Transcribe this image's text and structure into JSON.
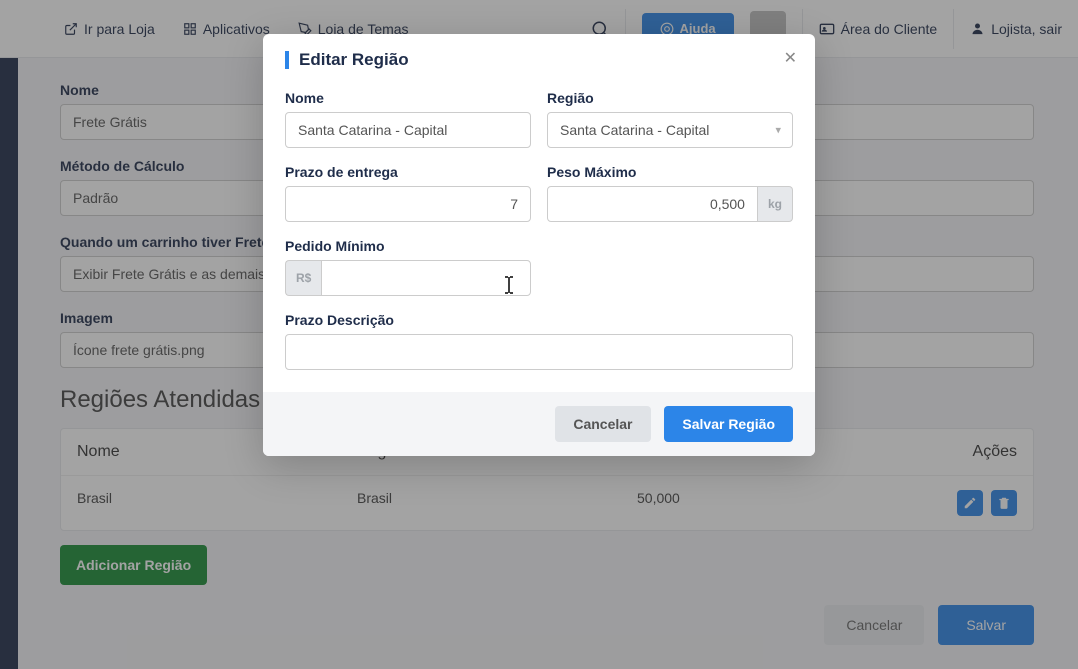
{
  "topbar": {
    "loja": "Ir para Loja",
    "aplicativos": "Aplicativos",
    "temas": "Loja de Temas",
    "ajuda": "Ajuda",
    "cliente": "Área do Cliente",
    "lojista": "Lojista, sair"
  },
  "bg_form": {
    "nome_label": "Nome",
    "nome_value": "Frete Grátis",
    "metodo_label": "Método de Cálculo",
    "metodo_value": "Padrão",
    "carrinho_label": "Quando um carrinho tiver Frete",
    "carrinho_value": "Exibir Frete Grátis e as demais",
    "imagem_label": "Imagem",
    "imagem_value": "Ícone frete grátis.png",
    "regioes_title": "Regiões Atendidas",
    "col_nome": "Nome",
    "col_regiao": "Região",
    "col_acoes": "Ações",
    "row_nome": "Brasil",
    "row_regiao": "Brasil",
    "row_peso": "50,000",
    "btn_add": "Adicionar Região",
    "btn_cancel": "Cancelar",
    "btn_save": "Salvar"
  },
  "modal": {
    "title": "Editar Região",
    "nome_label": "Nome",
    "nome_value": "Santa Catarina - Capital",
    "regiao_label": "Região",
    "regiao_value": "Santa Catarina - Capital",
    "prazo_label": "Prazo de entrega",
    "prazo_value": "7",
    "peso_label": "Peso Máximo",
    "peso_value": "0,500",
    "peso_unit": "kg",
    "pedido_label": "Pedido Mínimo",
    "pedido_prefix": "R$",
    "pedido_value": "",
    "prazo_desc_label": "Prazo Descrição",
    "prazo_desc_value": "",
    "btn_cancel": "Cancelar",
    "btn_save": "Salvar Região"
  }
}
